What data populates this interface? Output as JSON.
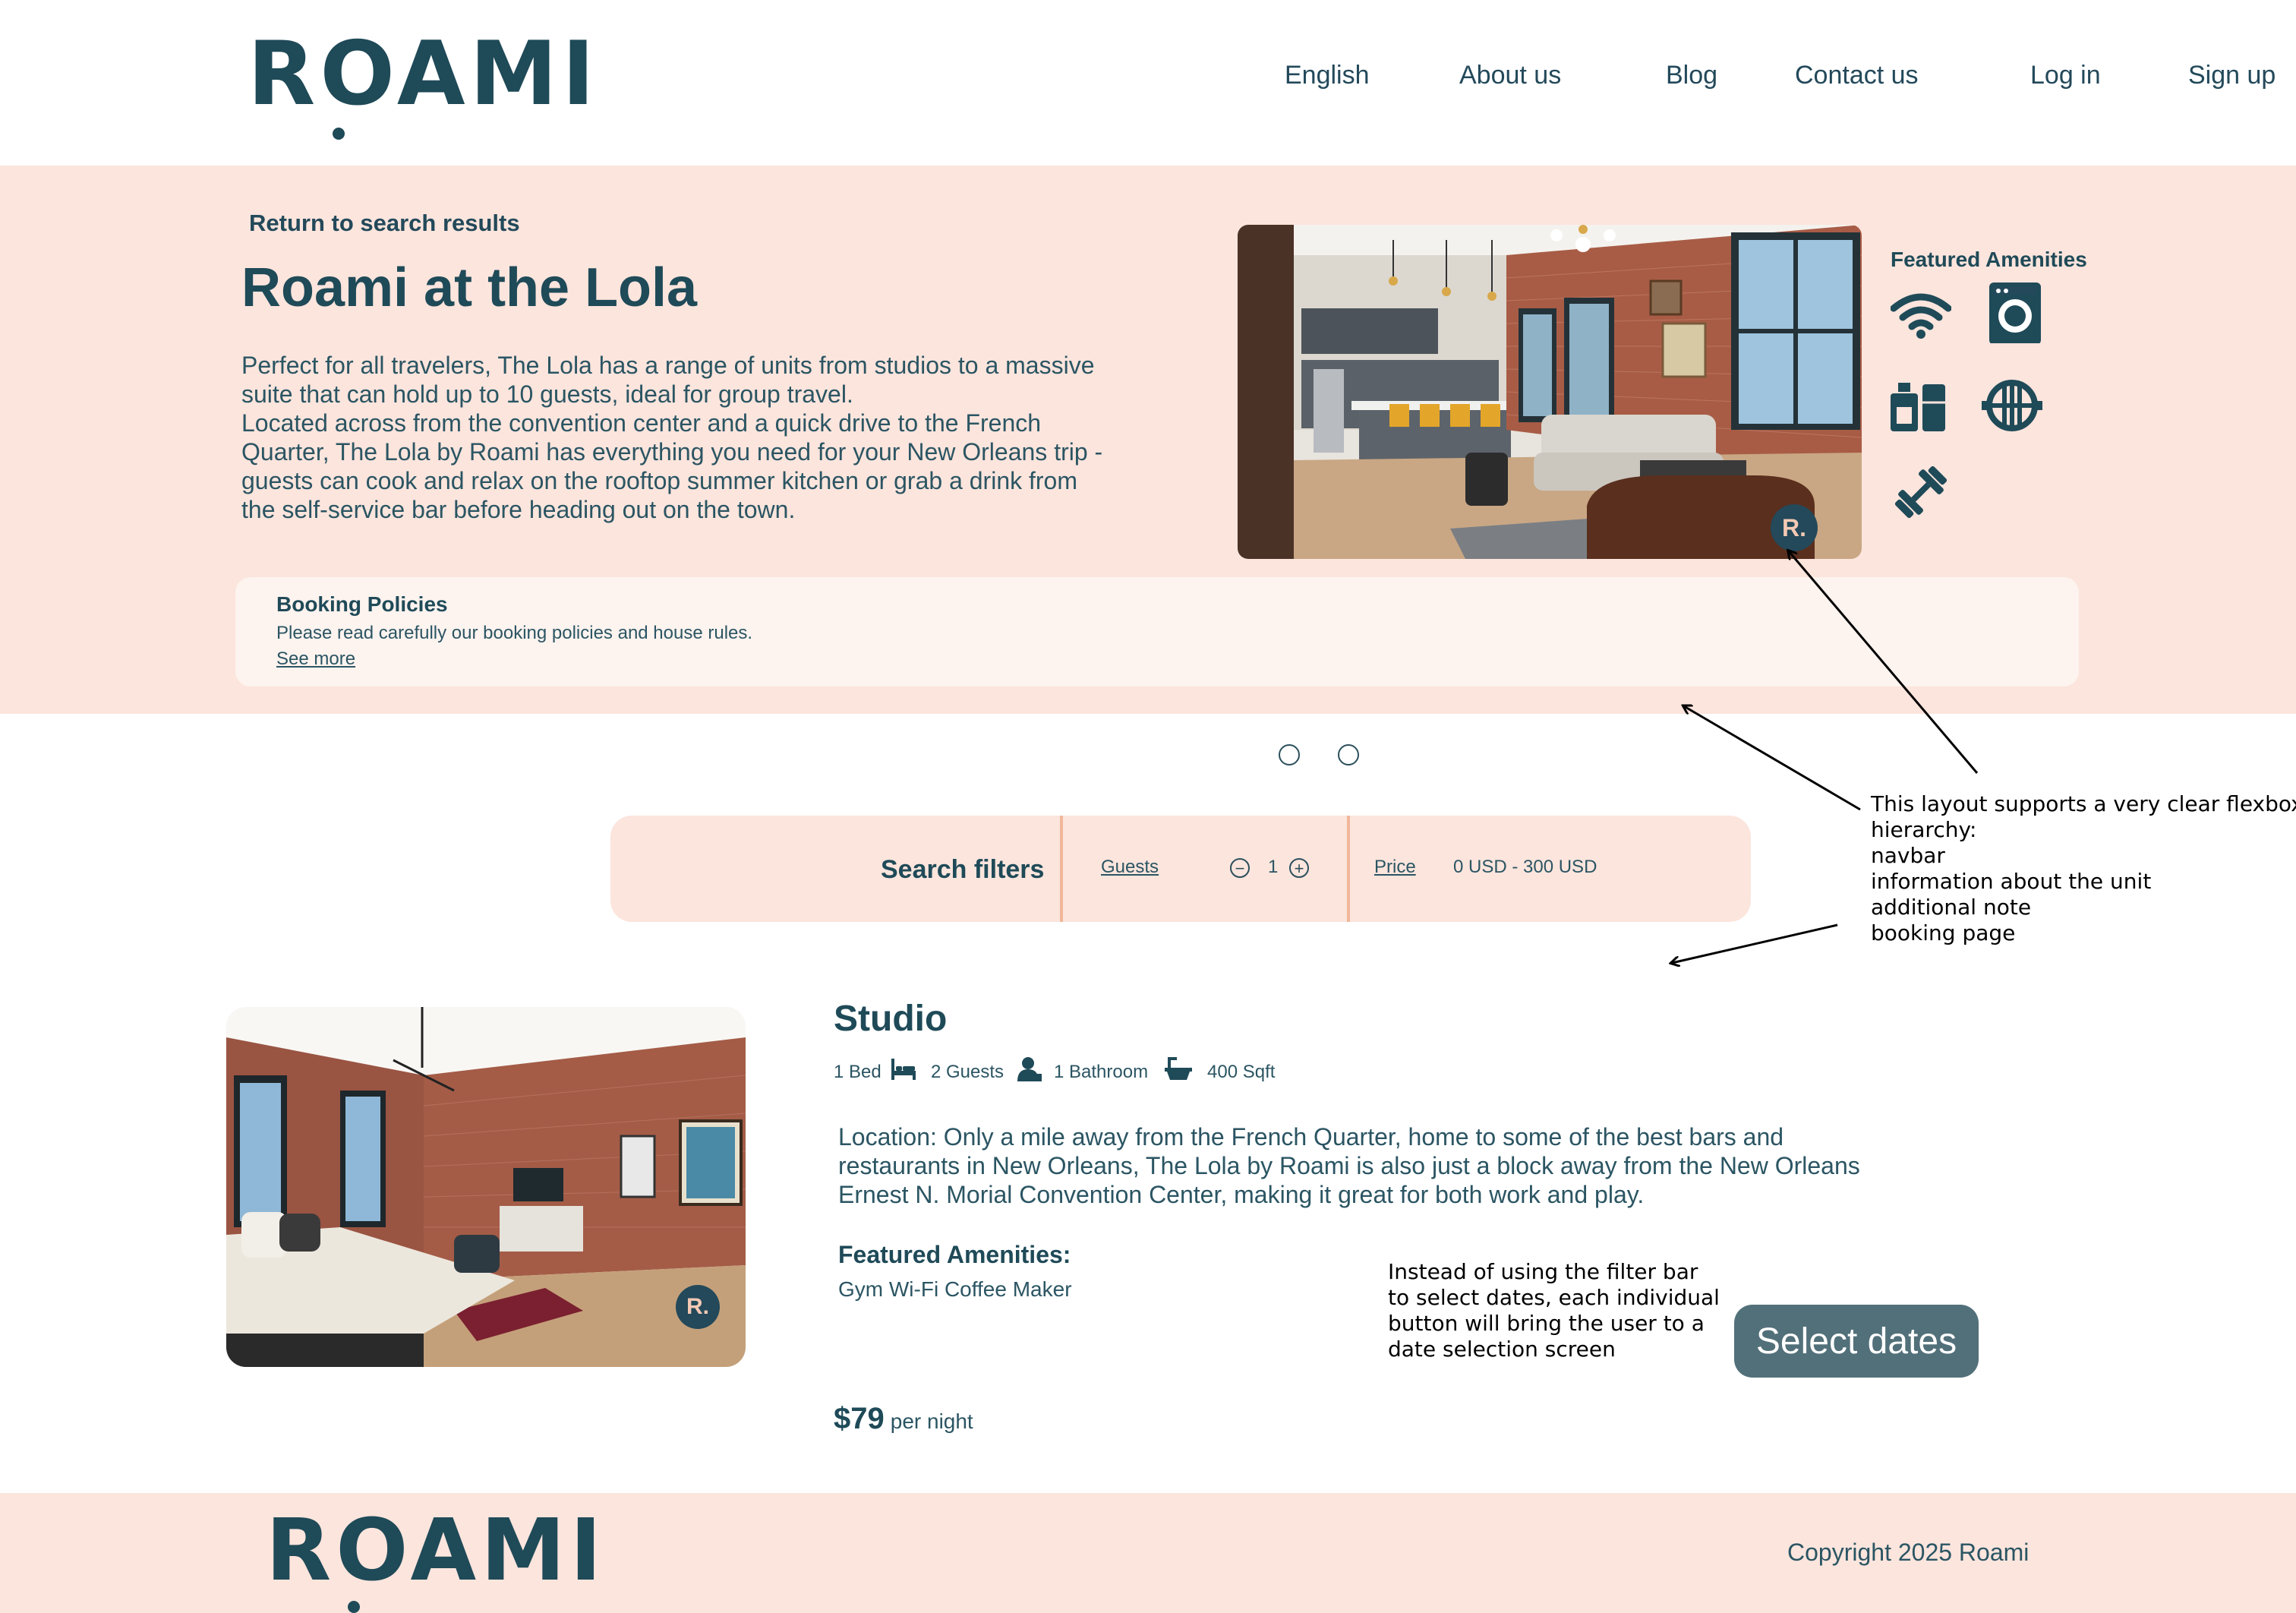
{
  "brand": {
    "logo_text": "ROAMI"
  },
  "nav": {
    "language": "English",
    "about": "About us",
    "blog": "Blog",
    "contact": "Contact us",
    "login": "Log in",
    "signup": "Sign up"
  },
  "hero": {
    "return_link": "Return to search results",
    "title": "Roami at the Lola",
    "description_lines": [
      "Perfect for all travelers, The Lola has a range of units from studios to a massive",
      "suite that can hold up to 10 guests, ideal for group travel.",
      "Located across from the convention center and a quick drive to the French",
      "Quarter, The Lola by Roami has everything you need for your New Orleans trip -",
      "guests can cook and relax on the rooftop summer kitchen or grab a drink from",
      "the self-service bar before heading out on the town."
    ],
    "photo_badge": "R.",
    "featured_amenities_title": "Featured Amenities",
    "amenity_icons": [
      "wifi-icon",
      "washing-machine-icon",
      "kitchen-appliances-icon",
      "grill-icon",
      "dumbbell-icon"
    ]
  },
  "booking_policies": {
    "title": "Booking Policies",
    "text": "Please read carefully our booking policies and house rules.",
    "link": "See more"
  },
  "carousel": {
    "dots": 2
  },
  "filters": {
    "title": "Search filters",
    "guests_label": "Guests",
    "guests_value": "1",
    "decrement": "−",
    "increment": "+",
    "price_label": "Price",
    "price_range": "0 USD - 300 USD"
  },
  "listing": {
    "title": "Studio",
    "beds": "1 Bed",
    "guests": "2 Guests",
    "bathrooms": "1 Bathroom",
    "size": "400 Sqft",
    "description_lines": [
      "Location: Only a mile away from the French Quarter, home to some of the best bars and",
      "restaurants in New Orleans, The Lola by Roami is also just a block away from the New Orleans",
      "Ernest N. Morial Convention Center, making it great for both work and play."
    ],
    "amenities_heading": "Featured Amenities:",
    "amenities": "Gym Wi-Fi Coffee Maker",
    "price": "$79",
    "price_unit": "per night",
    "select_button": "Select dates",
    "photo_badge": "R."
  },
  "annotations": {
    "layout_note_lines": [
      "This layout supports a very clear flexbox",
      "hierarchy:",
      "navbar",
      "information about the unit",
      "additional note",
      "booking page"
    ],
    "button_note_lines": [
      "Instead of using the filter bar",
      "to select dates, each individual",
      "button will bring the user to a",
      "date selection screen"
    ]
  },
  "footer": {
    "logo_text": "ROAMI",
    "copyright": "Copyright 2025 Roami"
  },
  "colors": {
    "primary": "#1f4a58",
    "peach": "#fce5dd",
    "button": "#52707a",
    "divider": "#f0b79a"
  }
}
